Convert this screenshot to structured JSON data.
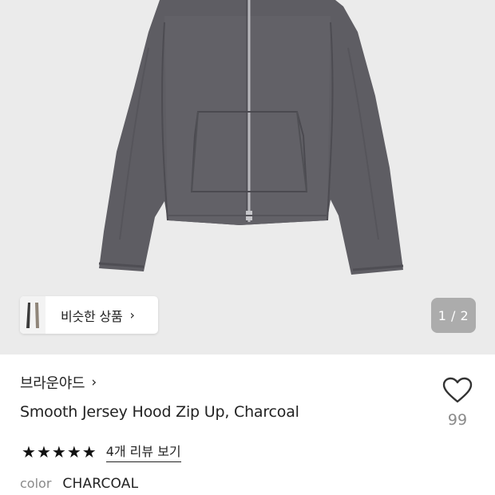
{
  "gallery": {
    "image_alt": "charcoal zip-up jacket",
    "similar_label": "비슷한 상품",
    "similar_chevron": "›",
    "pager": "1 / 2"
  },
  "product": {
    "brand": "브라운야드",
    "brand_chevron": "›",
    "title": "Smooth Jersey Hood Zip Up, Charcoal",
    "rating_stars": 5,
    "review_link": "4개 리뷰 보기",
    "wish_count": "99",
    "option_label": "color",
    "option_value": "CHARCOAL"
  },
  "colors": {
    "jacket": "#5e5d63",
    "background": "#ebebeb",
    "text": "#222222",
    "muted": "#8a8a8a"
  },
  "icons": {
    "wish": "heart-outline-icon",
    "star": "star-filled-icon"
  }
}
